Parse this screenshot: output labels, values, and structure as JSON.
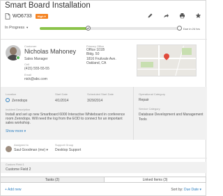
{
  "header": {
    "title": "Smart Board Installation",
    "wo_number": "WO6733",
    "priority": "High ▾",
    "icons": [
      "pencil-icon",
      "share-icon",
      "print-icon",
      "star-icon"
    ]
  },
  "status": {
    "label": "In Progress",
    "progress_fraction": 0.35,
    "due": "Due in 24 hrs"
  },
  "customer": {
    "label": "Customer",
    "name": "Nicholas Mahoney",
    "title": "Sales Manager",
    "cell_label": "Cell",
    "cell": "(415) 555-55-55",
    "email_label": "Email",
    "email": "nick@abc.com"
  },
  "office": {
    "label": "Primary Office",
    "lines": [
      "Office 101B",
      "Bldg. 50",
      "1816 Fruitvale Ave.",
      "Oakland, CA"
    ]
  },
  "details": {
    "location_label": "Location",
    "location": "Zenndops",
    "start_label": "Start Date",
    "start": "4/1/2014",
    "sched_label": "Scheduled Start Date",
    "sched": "3/29/2014",
    "op_cat_label": "Operational Category",
    "op_cat": "Repair",
    "svc_cat_label": "Service Category",
    "svc_cat_1": "Database Development and Management",
    "svc_cat_2": "Tools",
    "incident_label": "Incident Description",
    "incident": "Install and set up new Smartboard 6000 Interactive Whiteboard in conference room Zenndops. Will need the log from the EOD to connect for an important sales workshop.",
    "show_more": "Show more ▾"
  },
  "assignment": {
    "assigned_label": "Assigned to",
    "assigned": "Saul Goodman (me) ▾",
    "group_label": "Support Group",
    "group": "Desktop Support"
  },
  "custom": {
    "label": "Custom Field 1",
    "value": "Custome Field 2"
  },
  "tabs": [
    {
      "label": "Tasks (2)",
      "active": true
    },
    {
      "label": "Linked Items (3)",
      "active": false
    }
  ],
  "footer": {
    "add_new": "+ Add new",
    "sort_label": "Sort by:",
    "sort_value": "Due Date ▾"
  },
  "colors": {
    "accent": "#2f80c0",
    "progress": "#8bc34a",
    "badge": "#f58220"
  }
}
